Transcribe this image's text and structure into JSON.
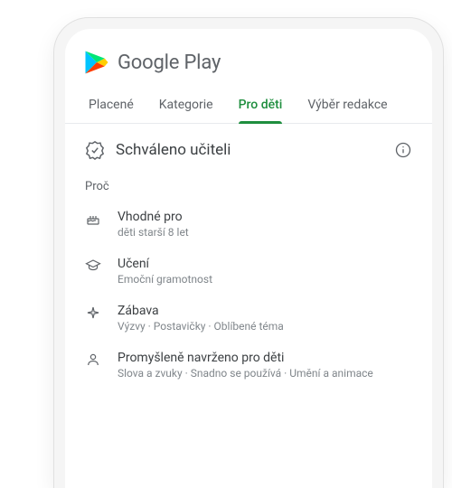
{
  "brand": "Google Play",
  "tabs": [
    {
      "label": "Placené",
      "active": false
    },
    {
      "label": "Kategorie",
      "active": false
    },
    {
      "label": "Pro děti",
      "active": true
    },
    {
      "label": "Výběr redakce",
      "active": false
    }
  ],
  "approved": {
    "title": "Schváleno učiteli"
  },
  "section_label": "Proč",
  "items": [
    {
      "icon": "cake",
      "title": "Vhodné pro",
      "sub": "děti starší 8 let"
    },
    {
      "icon": "grad",
      "title": "Učení",
      "sub": "Emoční gramotnost"
    },
    {
      "icon": "sparkle",
      "title": "Zábava",
      "sub": "Výzvy · Postavičky · Oblíbené téma"
    },
    {
      "icon": "person",
      "title": "Promyšleně navrženo pro děti",
      "sub": "Slova a zvuky · Snadno se používá · Umění a animace"
    }
  ]
}
